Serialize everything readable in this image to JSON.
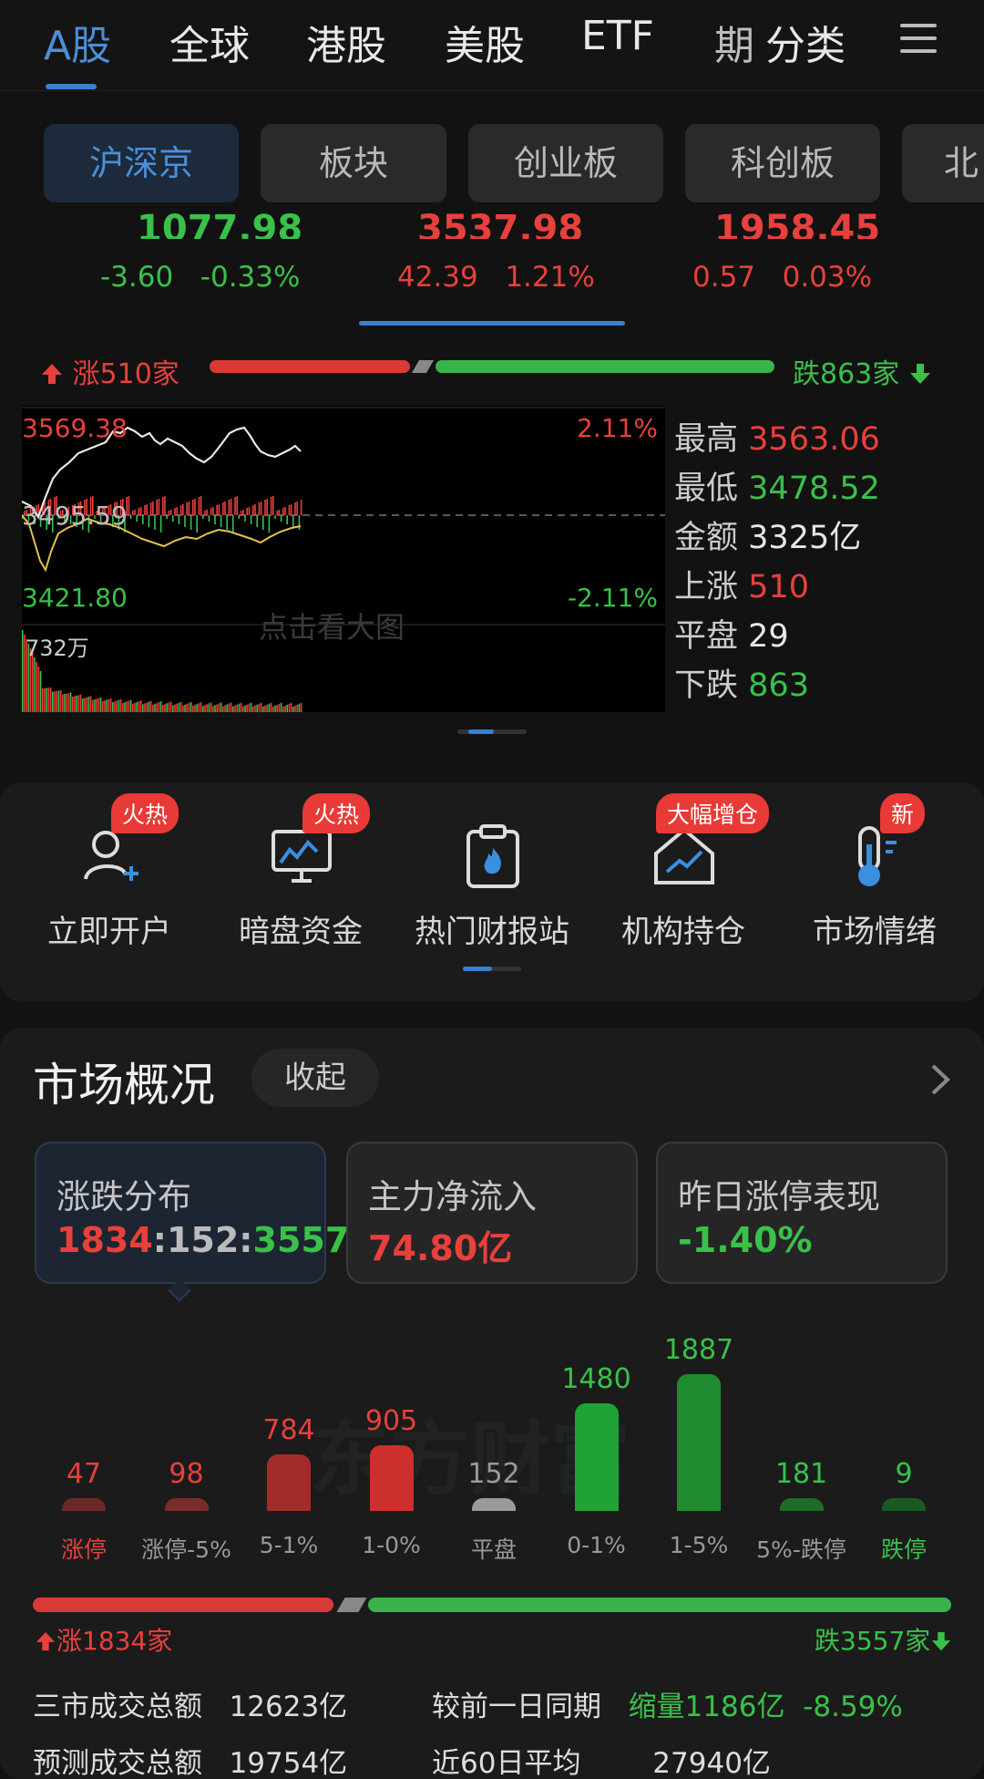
{
  "top_tabs": [
    "A股",
    "全球",
    "港股",
    "美股",
    "ETF",
    "期",
    "分类"
  ],
  "sub_tabs": [
    "沪深京",
    "板块",
    "创业板",
    "科创板",
    "北"
  ],
  "indices": [
    {
      "value": "1077.98",
      "change": "-3.60",
      "pct": "-0.33%",
      "color": "green"
    },
    {
      "value": "3537.98",
      "change": "42.39",
      "pct": "1.21%",
      "color": "red"
    },
    {
      "value": "1958.45",
      "change": "0.57",
      "pct": "0.03%",
      "color": "red"
    }
  ],
  "breadth": {
    "up": "涨510家",
    "down": "跌863家"
  },
  "chart": {
    "high_label": "3569.38",
    "mid_label": "3495.59",
    "low_label": "3421.80",
    "high_pct": "2.11%",
    "low_pct": "-2.11%",
    "volume_label": "732万",
    "watermark": "点击看大图"
  },
  "stats": [
    {
      "label": "最高",
      "value": "3563.06",
      "color": "red"
    },
    {
      "label": "最低",
      "value": "3478.52",
      "color": "green"
    },
    {
      "label": "金额",
      "value": "3325亿",
      "color": "white"
    },
    {
      "label": "上涨",
      "value": "510",
      "color": "red"
    },
    {
      "label": "平盘",
      "value": "29",
      "color": "white"
    },
    {
      "label": "下跌",
      "value": "863",
      "color": "green"
    }
  ],
  "shortcuts": [
    {
      "label": "立即开户",
      "badge": "火热",
      "icon": "add-user-icon"
    },
    {
      "label": "暗盘资金",
      "badge": "火热",
      "icon": "monitor-chart-icon"
    },
    {
      "label": "热门财报站",
      "badge": "",
      "icon": "fire-clipboard-icon"
    },
    {
      "label": "机构持仓",
      "badge": "大幅增仓",
      "icon": "house-trend-icon"
    },
    {
      "label": "市场情绪",
      "badge": "新",
      "icon": "thermometer-icon"
    }
  ],
  "market": {
    "title": "市场概况",
    "collapse": "收起",
    "boxes": [
      {
        "title": "涨跌分布",
        "value_up": "1834",
        "value_flat": "152",
        "value_down": "3557",
        "sep": ":"
      },
      {
        "title": "主力净流入",
        "value": "74.80亿"
      },
      {
        "title": "昨日涨停表现",
        "value": "-1.40%"
      }
    ],
    "watermark": "东方财富"
  },
  "chart_data": {
    "type": "bar",
    "categories": [
      "涨停",
      "涨停-5%",
      "5-1%",
      "1-0%",
      "平盘",
      "0-1%",
      "1-5%",
      "5%-跌停",
      "跌停"
    ],
    "values": [
      47,
      98,
      784,
      905,
      152,
      1480,
      1887,
      181,
      9
    ]
  },
  "breadth2": {
    "up": "涨1834家",
    "down": "跌3557家"
  },
  "bottom": {
    "total_label": "三市成交总额",
    "total_value": "12623亿",
    "compare_label": "较前一日同期",
    "compare_value": "缩量1186亿",
    "compare_pct": "-8.59%",
    "forecast_label": "预测成交总额",
    "forecast_value": "19754亿",
    "avg_label": "近60日平均",
    "avg_value": "27940亿"
  },
  "colors": {
    "up": "#e8403c",
    "down": "#39c14a",
    "accent": "#4a8fd9",
    "bg": "#121212"
  }
}
